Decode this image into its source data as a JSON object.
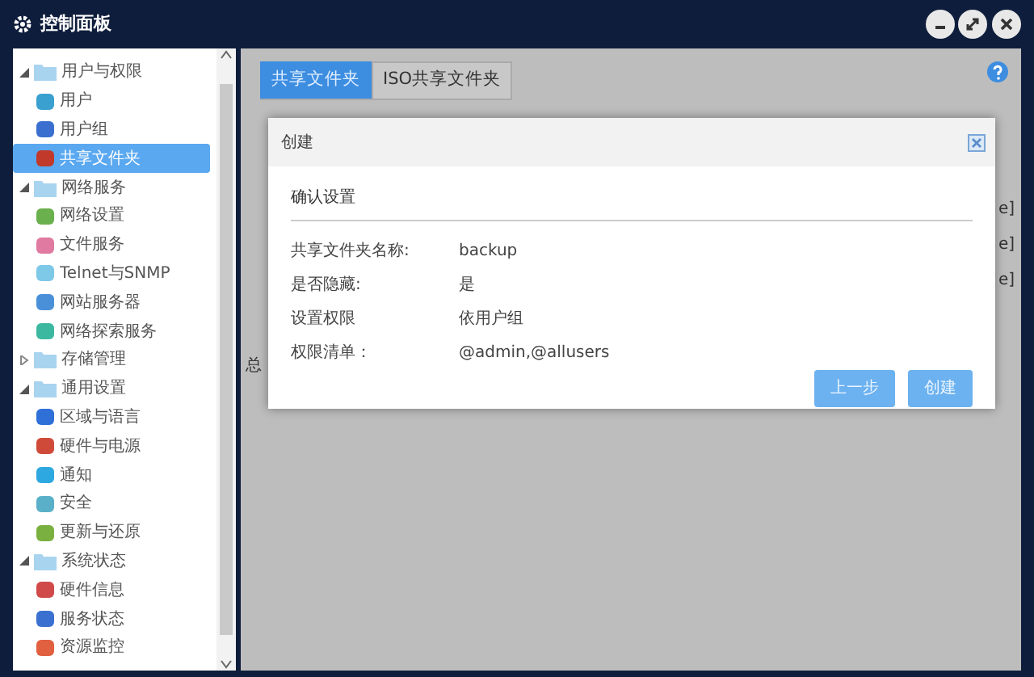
{
  "window": {
    "title": "控制面板"
  },
  "sidebar": {
    "items": [
      {
        "label": "用户与权限",
        "expanded": true,
        "children": [
          {
            "label": "用户",
            "selected": false
          },
          {
            "label": "用户组",
            "selected": false
          },
          {
            "label": "共享文件夹",
            "selected": true
          }
        ]
      },
      {
        "label": "网络服务",
        "expanded": true,
        "children": [
          {
            "label": "网络设置",
            "selected": false
          },
          {
            "label": "文件服务",
            "selected": false
          },
          {
            "label": "Telnet与SNMP",
            "selected": false
          },
          {
            "label": "网站服务器",
            "selected": false
          },
          {
            "label": "网络探索服务",
            "selected": false
          }
        ]
      },
      {
        "label": "存储管理",
        "expanded": false
      },
      {
        "label": "通用设置",
        "expanded": true,
        "children": [
          {
            "label": "区域与语言",
            "selected": false
          },
          {
            "label": "硬件与电源",
            "selected": false
          },
          {
            "label": "通知",
            "selected": false
          },
          {
            "label": "安全",
            "selected": false
          },
          {
            "label": "更新与还原",
            "selected": false
          }
        ]
      },
      {
        "label": "系统状态",
        "expanded": true,
        "children": [
          {
            "label": "硬件信息",
            "selected": false
          },
          {
            "label": "服务状态",
            "selected": false
          },
          {
            "label": "资源监控",
            "selected": false
          }
        ]
      }
    ]
  },
  "tabs": [
    {
      "label": "共享文件夹",
      "selected": true
    },
    {
      "label": "ISO共享文件夹",
      "selected": false
    }
  ],
  "background": {
    "cell_fragments": [
      "e]",
      "e]",
      "e]"
    ],
    "footer_fragment": "总"
  },
  "dialog": {
    "title": "创建",
    "heading": "确认设置",
    "rows": [
      {
        "label": "共享文件夹名称:",
        "value": "backup"
      },
      {
        "label": "是否隐藏:",
        "value": "是"
      },
      {
        "label": "设置权限",
        "value": "依用户组"
      },
      {
        "label": "权限清单：",
        "value": "@admin,@allusers"
      }
    ],
    "buttons": [
      "上一步",
      "创建"
    ]
  }
}
